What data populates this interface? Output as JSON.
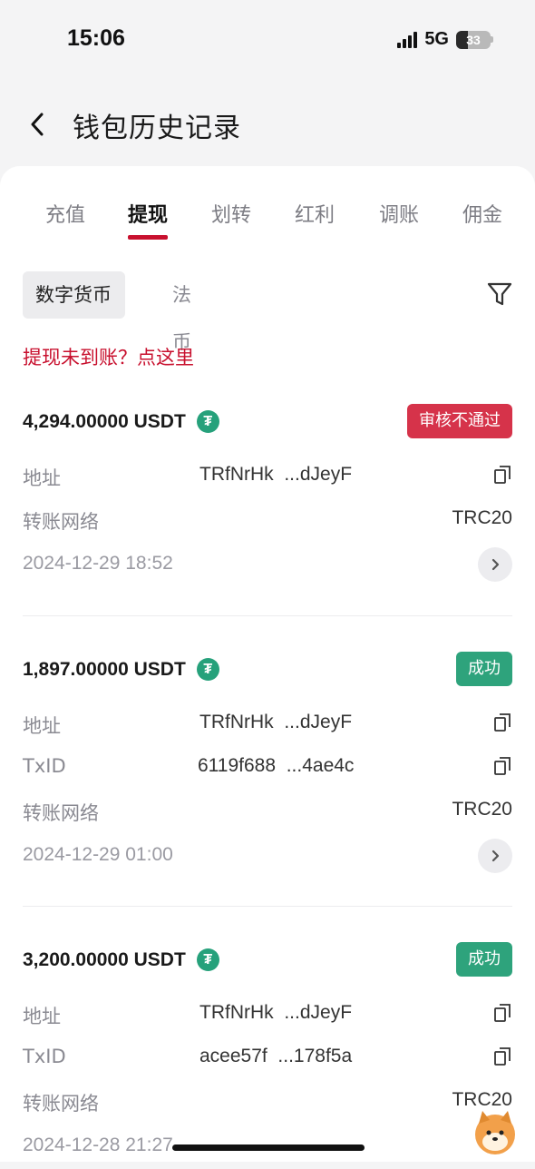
{
  "status": {
    "time": "15:06",
    "network": "5G",
    "battery": "33",
    "battery_level": 0.33
  },
  "nav": {
    "title": "钱包历史记录",
    "back_icon": "chevron-left-icon"
  },
  "tabs": [
    {
      "label": "充值"
    },
    {
      "label": "提现",
      "active": true
    },
    {
      "label": "划转"
    },
    {
      "label": "红利"
    },
    {
      "label": "调账"
    },
    {
      "label": "佣金"
    }
  ],
  "segment": {
    "crypto": "数字货币",
    "fiat": "法币",
    "filter_icon": "filter-icon"
  },
  "notice": "提现未到账？点这里",
  "labels": {
    "address": "地址",
    "txid": "TxID",
    "network": "转账网络"
  },
  "records": [
    {
      "amount": "4,294.00000 USDT",
      "status": "审核不通过",
      "address_start": "TRfNrHk",
      "address_end": "...dJeyF",
      "network": "TRC20",
      "time": "2024-12-29 18:52"
    },
    {
      "amount": "1,897.00000 USDT",
      "status": "成功",
      "address_start": "TRfNrHk",
      "address_end": "...dJeyF",
      "txid_start": "6119f688",
      "txid_end": "...4ae4c",
      "network": "TRC20",
      "time": "2024-12-29 01:00"
    },
    {
      "amount": "3,200.00000 USDT",
      "status": "成功",
      "address_start": "TRfNrHk",
      "address_end": "...dJeyF",
      "txid_start": "acee57f",
      "txid_end": "...178f5a",
      "network": "TRC20",
      "time": "2024-12-28 21:27"
    }
  ],
  "colors": {
    "accent": "#c8102e",
    "success": "#2ea37c",
    "fail": "#d6334a",
    "usdt": "#26a17b"
  }
}
